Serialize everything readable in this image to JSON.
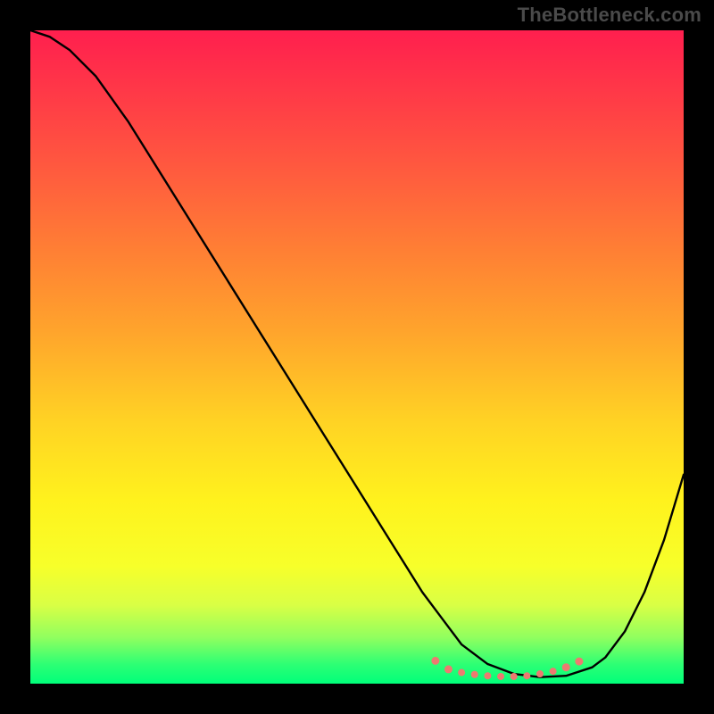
{
  "watermark": "TheBottleneck.com",
  "chart_data": {
    "type": "line",
    "title": "",
    "xlabel": "",
    "ylabel": "",
    "xlim": [
      0,
      100
    ],
    "ylim": [
      0,
      100
    ],
    "grid": false,
    "legend": false,
    "series": [
      {
        "name": "bottleneck-curve",
        "x": [
          0,
          3,
          6,
          10,
          15,
          20,
          25,
          30,
          35,
          40,
          45,
          50,
          55,
          60,
          63,
          66,
          70,
          74,
          78,
          82,
          86,
          88,
          91,
          94,
          97,
          100
        ],
        "y": [
          100,
          99,
          97,
          93,
          86,
          78,
          70,
          62,
          54,
          46,
          38,
          30,
          22,
          14,
          10,
          6,
          3,
          1.5,
          1,
          1.2,
          2.5,
          4,
          8,
          14,
          22,
          32
        ]
      }
    ],
    "markers": {
      "name": "highlight-points",
      "color": "#ed7a70",
      "points": [
        {
          "x": 62,
          "y": 3.5,
          "r": 4.5
        },
        {
          "x": 64,
          "y": 2.2,
          "r": 4.5
        },
        {
          "x": 66,
          "y": 1.7,
          "r": 4.0
        },
        {
          "x": 68,
          "y": 1.4,
          "r": 4.0
        },
        {
          "x": 70,
          "y": 1.2,
          "r": 4.0
        },
        {
          "x": 72,
          "y": 1.1,
          "r": 4.0
        },
        {
          "x": 74,
          "y": 1.1,
          "r": 4.0
        },
        {
          "x": 76,
          "y": 1.2,
          "r": 4.0
        },
        {
          "x": 78,
          "y": 1.5,
          "r": 4.0
        },
        {
          "x": 80,
          "y": 1.9,
          "r": 4.0
        },
        {
          "x": 82,
          "y": 2.5,
          "r": 4.5
        },
        {
          "x": 84,
          "y": 3.4,
          "r": 4.5
        }
      ]
    },
    "background_gradient": {
      "type": "vertical",
      "top_color": "#ff1f4e",
      "bottom_color": "#00ff7a"
    }
  }
}
